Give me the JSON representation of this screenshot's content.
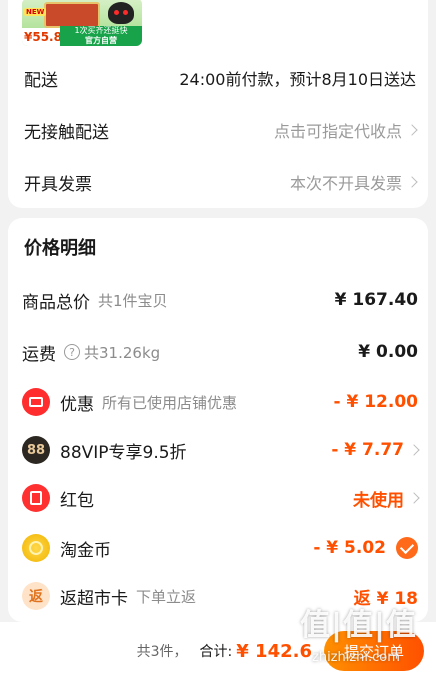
{
  "product": {
    "new_tag": "NEW",
    "price": "¥55.8",
    "banner_line1": "1次买齐还挺快",
    "banner_line2": "官方自营"
  },
  "delivery": {
    "label": "配送",
    "value": "24:00前付款，预计8月10日送达"
  },
  "contactless": {
    "label": "无接触配送",
    "value": "点击可指定代收点"
  },
  "invoice": {
    "label": "开具发票",
    "value": "本次不开具发票"
  },
  "price_detail": {
    "title": "价格明细",
    "goods_total": {
      "label": "商品总价",
      "sub": "共1件宝贝",
      "amount": "¥ 167.40"
    },
    "shipping": {
      "label": "运费",
      "sub": "共31.26kg",
      "amount": "¥ 0.00"
    },
    "discount": {
      "label": "优惠",
      "sub": "所有已使用店铺优惠",
      "amount": "- ¥ 12.00"
    },
    "vip": {
      "badge": "88",
      "label": "88VIP专享9.5折",
      "amount": "- ¥ 7.77"
    },
    "red_packet": {
      "label": "红包",
      "amount": "未使用"
    },
    "taojinbi": {
      "label": "淘金币",
      "amount": "- ¥ 5.02"
    },
    "fanchaoshi": {
      "badge": "返",
      "label": "返超市卡",
      "sub": "下单立返",
      "amount": "返 ¥ 18"
    }
  },
  "footer": {
    "count": "共3件，",
    "total_label": "合计:",
    "total": "¥ 142.6",
    "submit": "提交订单"
  },
  "watermark": {
    "text": "值|值|值",
    "url": "zhizhizhi.com"
  },
  "colors": {
    "accent": "#ff5000",
    "card": "#ffffff",
    "background": "#f2f2f2"
  }
}
